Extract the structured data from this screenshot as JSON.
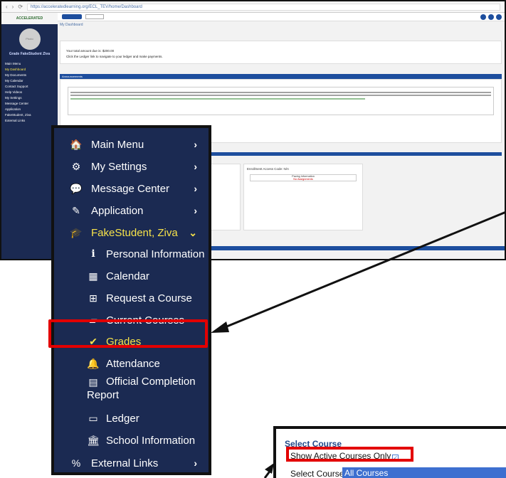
{
  "browser": {
    "url": "https://acceleratedlearning.org/ECL_TEV/home/Dashboard",
    "nav_back": "‹",
    "nav_fwd": "›",
    "reload": "⟳"
  },
  "app": {
    "logo_text": "ACCELERATED",
    "avatar_text": "Photo",
    "student_name": "Grade FakeStudent Ziva",
    "breadcrumb": "My Dashboard",
    "sidebar_items": [
      {
        "label": "Main Menu",
        "active": false
      },
      {
        "label": "My Dashboard",
        "active": true
      },
      {
        "label": "My Documents",
        "active": false
      },
      {
        "label": "My Calendar",
        "active": false
      },
      {
        "label": "Contact Support",
        "active": false
      },
      {
        "label": "Help Videos",
        "active": false
      },
      {
        "label": "My Settings",
        "active": false
      },
      {
        "label": "Message Center",
        "active": false
      },
      {
        "label": "Application",
        "active": false
      },
      {
        "label": "FakeStudent, Ziva",
        "active": false
      },
      {
        "label": "External Links",
        "active": false
      }
    ],
    "amount_due": "Your total amount due is: $200.00",
    "ledger_hint": "Click the Ledger link to navigate to your ledger and make payments.",
    "announcements_header": "Announcements",
    "enrollment_label": "Enrollment Access Code: N/A",
    "pi_header": "Pacing Information",
    "pi_value": "No Assignments"
  },
  "menu": {
    "items": [
      {
        "icon": "home-icon",
        "glyph": "🏠",
        "label": "Main Menu",
        "chevron": "›"
      },
      {
        "icon": "settings-icon",
        "glyph": "⚙",
        "label": "My Settings",
        "chevron": "›"
      },
      {
        "icon": "message-icon",
        "glyph": "💬",
        "label": "Message Center",
        "chevron": "›"
      },
      {
        "icon": "application-icon",
        "glyph": "✎",
        "label": "Application",
        "chevron": "›"
      },
      {
        "icon": "graduation-cap-icon",
        "glyph": "🎓",
        "label": "FakeStudent, Ziva",
        "chevron": "⌄"
      }
    ],
    "sub_items": [
      {
        "icon": "info-icon",
        "glyph": "i",
        "label": "Personal Information"
      },
      {
        "icon": "calendar-icon",
        "glyph": "▦",
        "label": "Calendar"
      },
      {
        "icon": "plus-square-icon",
        "glyph": "⊞",
        "label": "Request a Course"
      },
      {
        "icon": "book-icon",
        "glyph": "▰",
        "label": "Current Courses"
      },
      {
        "icon": "checkmark-icon",
        "glyph": "✔",
        "label": "Grades"
      },
      {
        "icon": "bell-icon",
        "glyph": "🔔",
        "label": "Attendance"
      }
    ],
    "report": {
      "icon": "document-icon",
      "glyph": "▤",
      "line1": "Official Completion",
      "line2": "Report"
    },
    "sub_items2": [
      {
        "icon": "credit-card-icon",
        "glyph": "▭",
        "label": "Ledger"
      },
      {
        "icon": "institution-icon",
        "glyph": "🏛",
        "label": "School Information"
      }
    ],
    "external": {
      "icon": "link-icon",
      "glyph": "%",
      "label": "External Links",
      "chevron": "›"
    }
  },
  "course_panel": {
    "title": "Select Course",
    "show_active_label": "Show Active Courses Only",
    "checkbox_checked": true,
    "select_label": "Select Course:",
    "select_value": "All Courses"
  },
  "colors": {
    "nav_bg": "#1b2a52",
    "accent_yellow": "#f7e34a",
    "highlight_red": "#e30000",
    "brand_blue": "#1d4e9e"
  }
}
